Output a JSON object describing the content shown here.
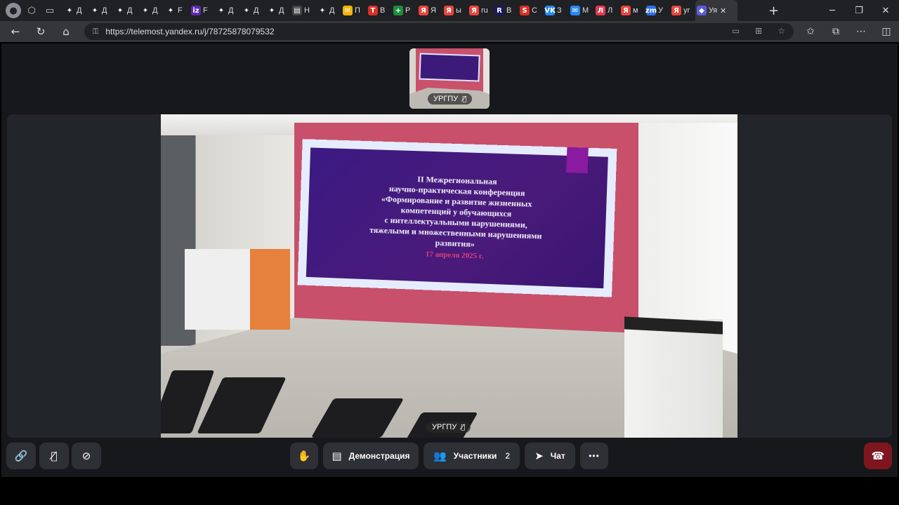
{
  "browser": {
    "tabs": [
      {
        "icon": "spark-icon",
        "title": "Д",
        "color": "#202124"
      },
      {
        "icon": "spark-icon",
        "title": "Д",
        "color": "#202124"
      },
      {
        "icon": "spark-icon",
        "title": "Д",
        "color": "#202124"
      },
      {
        "icon": "spark-icon",
        "title": "Д",
        "color": "#202124"
      },
      {
        "icon": "spark-icon",
        "title": "F",
        "color": "#202124"
      },
      {
        "icon": "iz-icon",
        "title": "F",
        "color": "#5b2ab0"
      },
      {
        "icon": "spark-icon",
        "title": "Д",
        "color": "#202124"
      },
      {
        "icon": "spark-icon",
        "title": "Д",
        "color": "#202124"
      },
      {
        "icon": "spark-icon",
        "title": "Д",
        "color": "#202124"
      },
      {
        "icon": "news-icon",
        "title": "Н",
        "color": "#444"
      },
      {
        "icon": "spark-icon",
        "title": "Д",
        "color": "#202124"
      },
      {
        "icon": "mail-icon",
        "title": "П",
        "color": "#f4b400"
      },
      {
        "icon": "t-icon",
        "title": "В",
        "color": "#d93025"
      },
      {
        "icon": "plus-icon",
        "title": "Р",
        "color": "#1e8e3e"
      },
      {
        "icon": "yandex-icon",
        "title": "Я",
        "color": "#e8453c"
      },
      {
        "icon": "yandex-icon",
        "title": "ы",
        "color": "#e8453c"
      },
      {
        "icon": "yandex-icon",
        "title": "ru",
        "color": "#e8453c"
      },
      {
        "icon": "r-icon",
        "title": "В",
        "color": "#1a1a5e"
      },
      {
        "icon": "s-icon",
        "title": "С",
        "color": "#d93025"
      },
      {
        "icon": "vk-icon",
        "title": "З",
        "color": "#2787f5"
      },
      {
        "icon": "chat-icon",
        "title": "М",
        "color": "#2787f5"
      },
      {
        "icon": "l-icon",
        "title": "Л",
        "color": "#e53950"
      },
      {
        "icon": "yandex-icon",
        "title": "м",
        "color": "#e8453c"
      },
      {
        "icon": "zm-icon",
        "title": "У",
        "color": "#2d6ee8"
      },
      {
        "icon": "yandex-icon",
        "title": "yr",
        "color": "#e8453c"
      },
      {
        "icon": "telemost-icon",
        "title": "Уя",
        "color": "#5b5bd6",
        "active": true
      }
    ],
    "tab_close": "✕",
    "new_tab": "+",
    "url": "https://telemost.yandex.ru/j/78725878079532"
  },
  "meeting": {
    "self_name": "УРГПУ",
    "main_name": "УРГПУ",
    "screen_lines": [
      "II Межрегиональная",
      "научно-практическая конференция",
      "«Формирование и развитие жизненных",
      "компетенций у обучающихся",
      "с интеллектуальными нарушениями,",
      "тяжелыми и множественными нарушениями",
      "развития»"
    ],
    "screen_date": "17 апреля 2025 г."
  },
  "toolbar": {
    "demo_label": "Демонстрация",
    "participants_label": "Участники",
    "participants_count": "2",
    "chat_label": "Чат",
    "more_label": "•••"
  },
  "colors": {
    "accent_hangup": "#7e1620",
    "control_bg": "#2d3035",
    "app_bg": "#16181c"
  }
}
